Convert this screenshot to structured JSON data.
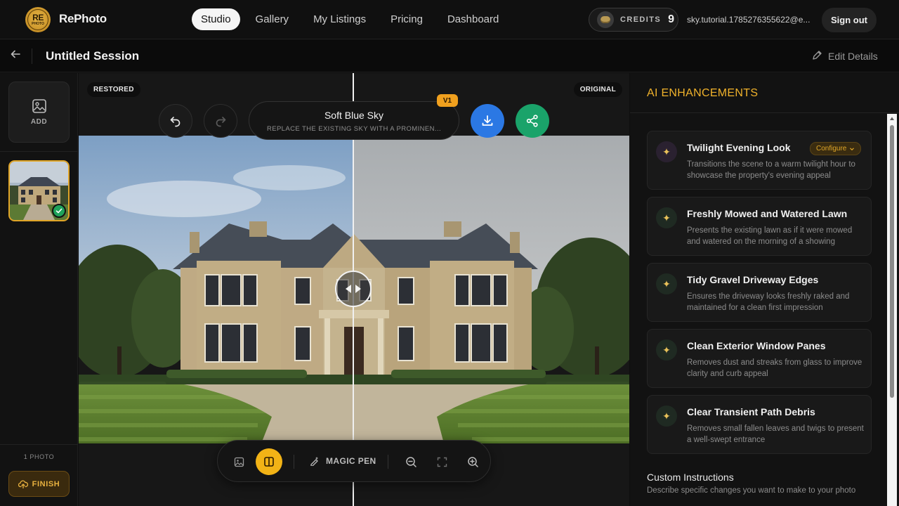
{
  "app": {
    "brand": "RePhoto",
    "logo_text": "RE",
    "logo_subtext": "PHOTO"
  },
  "nav": {
    "items": [
      {
        "label": "Studio",
        "active": true
      },
      {
        "label": "Gallery",
        "active": false
      },
      {
        "label": "My Listings",
        "active": false
      },
      {
        "label": "Pricing",
        "active": false
      },
      {
        "label": "Dashboard",
        "active": false
      }
    ]
  },
  "account": {
    "credits_label": "CREDITS",
    "credits_value": "9",
    "email": "sky.tutorial.1785276355622@e...",
    "signout_label": "Sign out"
  },
  "session": {
    "title": "Untitled Session",
    "edit_label": "Edit Details"
  },
  "leftrail": {
    "add_label": "ADD",
    "photo_count": "1 PHOTO",
    "finish_label": "FINISH"
  },
  "canvas": {
    "restored_label": "RESTORED",
    "original_label": "ORIGINAL",
    "prompt_title": "Soft Blue Sky",
    "prompt_subtitle": "REPLACE THE EXISTING SKY WITH A PROMINEN...",
    "version_badge": "V1",
    "magic_pen_label": "MAGIC PEN"
  },
  "enhancements": {
    "title": "AI ENHANCEMENTS",
    "cards": [
      {
        "title": "Twilight Evening Look",
        "description": "Transitions the scene to a warm twilight hour to showcase the property's evening appeal",
        "configure_label": "Configure",
        "icon": "sparkle-icon"
      },
      {
        "title": "Freshly Mowed and Watered Lawn",
        "description": "Presents the existing lawn as if it were mowed and watered on the morning of a showing",
        "icon": "sparkle-icon"
      },
      {
        "title": "Tidy Gravel Driveway Edges",
        "description": "Ensures the driveway looks freshly raked and maintained for a clean first impression",
        "icon": "sparkle-icon"
      },
      {
        "title": "Clean Exterior Window Panes",
        "description": "Removes dust and streaks from glass to improve clarity and curb appeal",
        "icon": "sparkle-icon"
      },
      {
        "title": "Clear Transient Path Debris",
        "description": "Removes small fallen leaves and twigs to present a well-swept entrance",
        "icon": "sparkle-icon"
      }
    ],
    "custom_title": "Custom Instructions",
    "custom_description": "Describe specific changes you want to make to your photo"
  },
  "colors": {
    "accent": "#f0b22b",
    "download": "#2b78e4",
    "share": "#1aa36a",
    "success": "#1ea35b"
  }
}
